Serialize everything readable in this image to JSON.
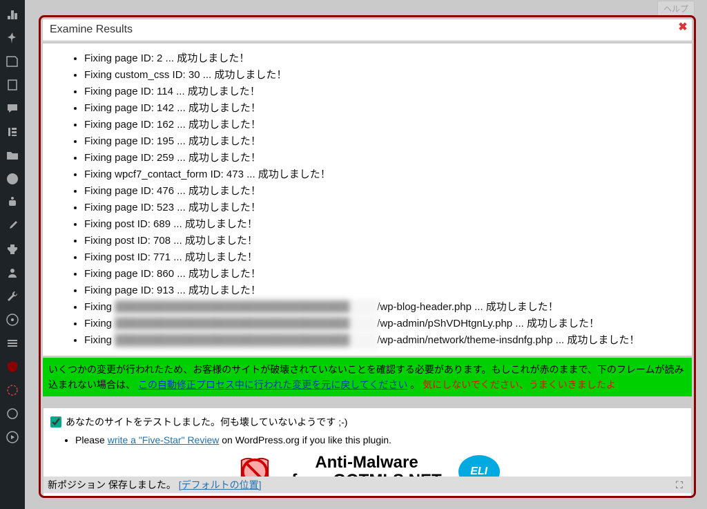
{
  "top_tab": "ヘルプ",
  "modal": {
    "title": "Examine Results",
    "items": [
      "Fixing page ID: 2 ... 成功しました！",
      "Fixing custom_css ID: 30 ... 成功しました！",
      "Fixing page ID: 114 ... 成功しました！",
      "Fixing page ID: 142 ... 成功しました！",
      "Fixing page ID: 162 ... 成功しました！",
      "Fixing page ID: 195 ... 成功しました！",
      "Fixing page ID: 259 ... 成功しました！",
      "Fixing wpcf7_contact_form ID: 473 ... 成功しました！",
      "Fixing page ID: 476 ... 成功しました！",
      "Fixing page ID: 523 ... 成功しました！",
      "Fixing post ID: 689 ... 成功しました！",
      "Fixing post ID: 708 ... 成功しました！",
      "Fixing post ID: 771 ... 成功しました！",
      "Fixing page ID: 860 ... 成功しました！",
      "Fixing page ID: 913 ... 成功しました！"
    ],
    "redacted": [
      {
        "prefix": "Fixing ",
        "suffix": "/wp-blog-header.php ... 成功しました！"
      },
      {
        "prefix": "Fixing ",
        "suffix": "/wp-admin/pShVDHtgnLy.php ... 成功しました！"
      },
      {
        "prefix": "Fixing ",
        "suffix": "/wp-admin/network/theme-insdnfg.php ... 成功しました！"
      }
    ]
  },
  "green": {
    "text1": "いくつかの変更が行われたため、お客様のサイトが破壊されていないことを確認する必要があります。もしこれが赤のままで、下のフレームが読み込まれない場合は、",
    "link": "この自動修正プロセス中に行われた変更を元に戻してください",
    "text2": "。 ",
    "warn": "気にしないでください、うまくいきましたよ"
  },
  "lower": {
    "checkbox_label": "あなたのサイトをテストしました。何も壊していないようです ;-)",
    "please": "Please ",
    "review_link": "write a \"Five-Star\" Review",
    "please_after": " on WordPress.org if you like this plugin.",
    "banner_title": "Anti-Malware",
    "banner_sub": "from GOTMLS.NET",
    "eli": "ELI"
  },
  "footer": {
    "text": "新ポジション 保存しました。 ",
    "link": "[デフォルトの位置]"
  }
}
